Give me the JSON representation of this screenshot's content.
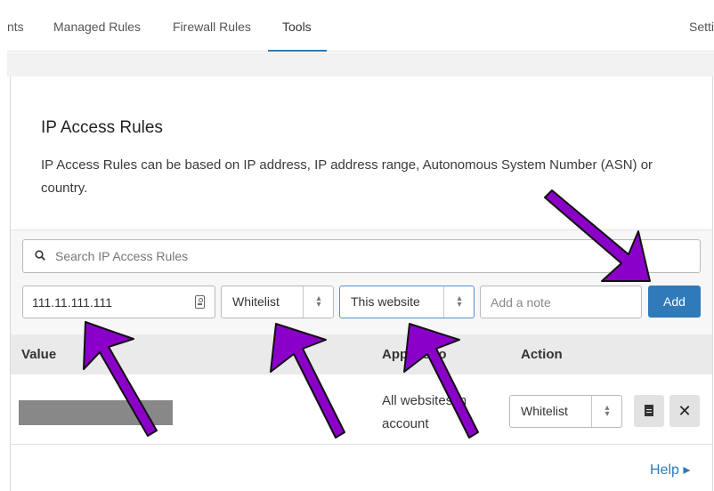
{
  "nav": {
    "tabs": [
      {
        "label": "nts"
      },
      {
        "label": "Managed Rules"
      },
      {
        "label": "Firewall Rules"
      },
      {
        "label": "Tools",
        "active": true
      },
      {
        "label": "Setti"
      }
    ]
  },
  "card": {
    "title": "IP Access Rules",
    "description": "IP Access Rules can be based on IP address, IP address range, Autonomous System Number (ASN) or country."
  },
  "search": {
    "placeholder": "Search IP Access Rules",
    "value": ""
  },
  "form": {
    "ip_value": "111.11.111.111",
    "mode_select": "Whitelist",
    "scope_select": "This website",
    "note_placeholder": "Add a note",
    "add_label": "Add"
  },
  "table": {
    "headers": {
      "value": "Value",
      "applies_to": "Applies to",
      "action": "Action"
    },
    "rows": [
      {
        "value": "",
        "applies_to": "All websites in account",
        "action": "Whitelist"
      }
    ]
  },
  "help": {
    "label": "Help ▸"
  },
  "colors": {
    "accent": "#2f7ab8",
    "annotation_arrow": "#8a00c8"
  },
  "icons": [
    "search-icon",
    "contact-card-icon",
    "select-arrows-icon",
    "document-icon",
    "close-icon"
  ]
}
